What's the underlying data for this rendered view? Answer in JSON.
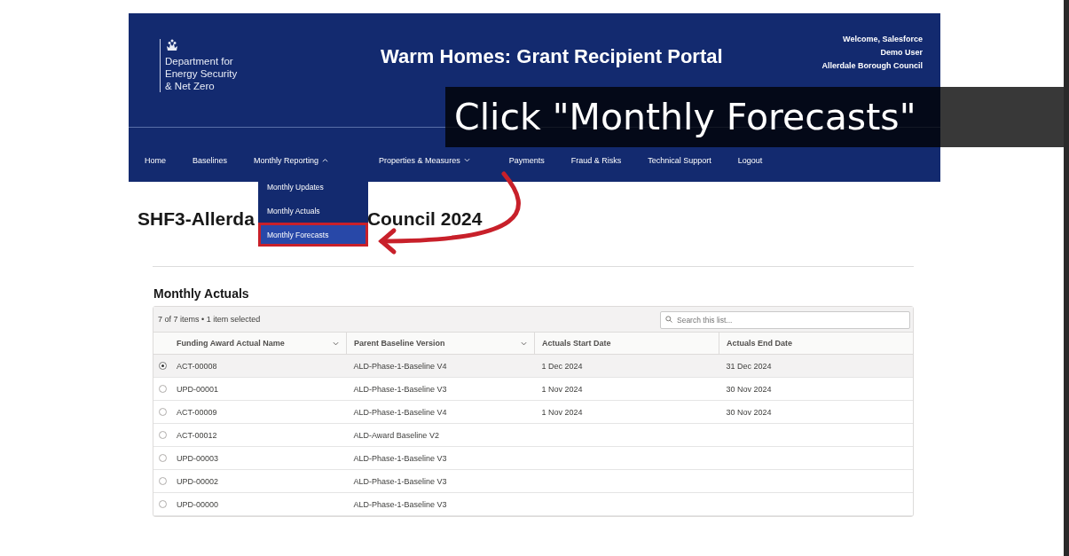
{
  "header": {
    "logo_lines": [
      "Department for",
      "Energy Security",
      "& Net Zero"
    ],
    "title": "Warm Homes: Grant Recipient Portal",
    "welcome_lines": [
      "Welcome, Salesforce",
      "Demo User",
      "Allerdale Borough Council"
    ]
  },
  "nav": [
    {
      "label": "Home",
      "kind": "link"
    },
    {
      "label": "Baselines",
      "kind": "link"
    },
    {
      "label": "Monthly Reporting",
      "kind": "menu",
      "expanded": true
    },
    {
      "label": "Properties & Measures",
      "kind": "menu",
      "expanded": false
    },
    {
      "label": "Payments",
      "kind": "link"
    },
    {
      "label": "Fraud & Risks",
      "kind": "link"
    },
    {
      "label": "Technical Support",
      "kind": "link"
    },
    {
      "label": "Logout",
      "kind": "link"
    }
  ],
  "dropdown": [
    {
      "label": "Monthly Updates",
      "selected": false
    },
    {
      "label": "Monthly Actuals",
      "selected": false
    },
    {
      "label": "Monthly Forecasts",
      "selected": true
    }
  ],
  "page_title_parts": [
    "SHF3-Allerda",
    "Council 2024"
  ],
  "section_title": "Monthly Actuals",
  "table": {
    "summary": "7 of 7 items • 1 item selected",
    "search": {
      "placeholder": "Search this list..."
    },
    "columns": [
      {
        "label": "Funding Award Actual Name",
        "kind": "menu"
      },
      {
        "label": "Parent Baseline Version",
        "kind": "menu"
      },
      {
        "label": "Actuals Start Date",
        "kind": "plain"
      },
      {
        "label": "Actuals End Date",
        "kind": "plain"
      }
    ],
    "rows": [
      {
        "selected": true,
        "cells": [
          "ACT-00008",
          "ALD-Phase-1-Baseline V4",
          "1 Dec 2024",
          "31 Dec 2024"
        ]
      },
      {
        "selected": false,
        "cells": [
          "UPD-00001",
          "ALD-Phase-1-Baseline V3",
          "1 Nov 2024",
          "30 Nov 2024"
        ]
      },
      {
        "selected": false,
        "cells": [
          "ACT-00009",
          "ALD-Phase-1-Baseline V4",
          "1 Nov 2024",
          "30 Nov 2024"
        ]
      },
      {
        "selected": false,
        "cells": [
          "ACT-00012",
          "ALD-Award Baseline V2",
          "",
          ""
        ]
      },
      {
        "selected": false,
        "cells": [
          "UPD-00003",
          "ALD-Phase-1-Baseline V3",
          "",
          ""
        ]
      },
      {
        "selected": false,
        "cells": [
          "UPD-00002",
          "ALD-Phase-1-Baseline V3",
          "",
          ""
        ]
      },
      {
        "selected": false,
        "cells": [
          "UPD-00000",
          "ALD-Phase-1-Baseline V3",
          "",
          ""
        ]
      }
    ]
  },
  "caption": "Click \"Monthly Forecasts\""
}
